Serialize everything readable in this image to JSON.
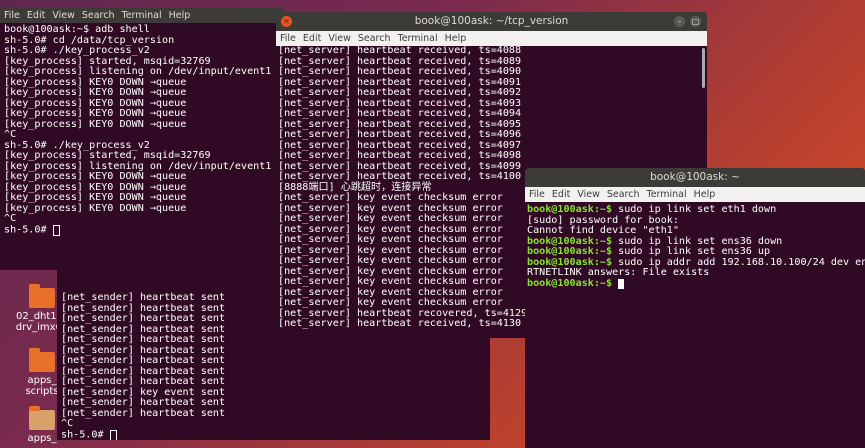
{
  "desktop": {
    "icons": [
      {
        "label": "02_dht11_\ndrv_imx6u"
      },
      {
        "label": "apps_\nscripts"
      },
      {
        "label": "apps_"
      }
    ]
  },
  "win1": {
    "menu": [
      "File",
      "Edit",
      "View",
      "Search",
      "Terminal",
      "Help"
    ],
    "lines": [
      "book@100ask:~$ adb shell",
      "sh-5.0# cd /data/tcp_version",
      "sh-5.0# ./key_process_v2",
      "[key_process] started, msqid=32769",
      "[key_process] listening on /dev/input/event1",
      "[key_process] KEY0 DOWN →queue",
      "[key_process] KEY0 DOWN →queue",
      "[key_process] KEY0 DOWN →queue",
      "[key_process] KEY0 DOWN →queue",
      "[key_process] KEY0 DOWN →queue",
      "^C",
      "sh-5.0# ./key_process_v2",
      "[key_process] started, msqid=32769",
      "[key_process] listening on /dev/input/event1",
      "[key_process] KEY0 DOWN →queue",
      "[key_process] KEY0 DOWN →queue",
      "[key_process] KEY0 DOWN →queue",
      "[key_process] KEY0 DOWN →queue",
      "^C",
      "sh-5.0# "
    ]
  },
  "win2": {
    "lines": [
      "[net_sender] heartbeat sent",
      "[net_sender] heartbeat sent",
      "[net_sender] heartbeat sent",
      "[net_sender] heartbeat sent",
      "[net_sender] heartbeat sent",
      "[net_sender] heartbeat sent",
      "[net_sender] heartbeat sent",
      "[net_sender] heartbeat sent",
      "[net_sender] heartbeat sent",
      "[net_sender] key event sent",
      "[net_sender] heartbeat sent",
      "[net_sender] heartbeat sent",
      "^C",
      "sh-5.0# "
    ]
  },
  "win3": {
    "title": "book@100ask: ~/tcp_version",
    "menu": [
      "File",
      "Edit",
      "View",
      "Search",
      "Terminal",
      "Help"
    ],
    "lines": [
      "[net_server] heartbeat received, ts=4088",
      "[net_server] heartbeat received, ts=4089",
      "[net_server] heartbeat received, ts=4090",
      "[net_server] heartbeat received, ts=4091",
      "[net_server] heartbeat received, ts=4092",
      "[net_server] heartbeat received, ts=4093",
      "[net_server] heartbeat received, ts=4094",
      "[net_server] heartbeat received, ts=4095",
      "[net_server] heartbeat received, ts=4096",
      "[net_server] heartbeat received, ts=4097",
      "[net_server] heartbeat received, ts=4098",
      "[net_server] heartbeat received, ts=4099",
      "[net_server] heartbeat received, ts=4100",
      "[8888端口] 心跳超时，连接异常",
      "[net_server] key event checksum error",
      "[net_server] key event checksum error",
      "[net_server] key event checksum error",
      "[net_server] key event checksum error",
      "[net_server] key event checksum error",
      "[net_server] key event checksum error",
      "[net_server] key event checksum error",
      "[net_server] key event checksum error",
      "[net_server] key event checksum error",
      "[net_server] key event checksum error",
      "[net_server] key event checksum error",
      "[net_server] heartbeat recovered, ts=4129",
      "[net_server] heartbeat received, ts=4130"
    ]
  },
  "win4": {
    "title": "book@100ask: ~",
    "menu": [
      "File",
      "Edit",
      "View",
      "Search",
      "Terminal",
      "Help"
    ],
    "prompt": "book@100ask:~$",
    "lines": [
      {
        "prompt": true,
        "text": " sudo ip link set eth1 down"
      },
      {
        "prompt": false,
        "text": "[sudo] password for book:"
      },
      {
        "prompt": false,
        "text": "Cannot find device \"eth1\""
      },
      {
        "prompt": true,
        "text": " sudo ip link set ens36 down"
      },
      {
        "prompt": true,
        "text": " sudo ip link set ens36 up"
      },
      {
        "prompt": true,
        "text": " sudo ip addr add 192.168.10.100/24 dev ens36"
      },
      {
        "prompt": false,
        "text": "RTNETLINK answers: File exists"
      },
      {
        "prompt": true,
        "text": " "
      }
    ]
  },
  "colors": {
    "prompt": "#8ae234",
    "terminal_bg": "#300a24",
    "accent": "#e95420"
  }
}
